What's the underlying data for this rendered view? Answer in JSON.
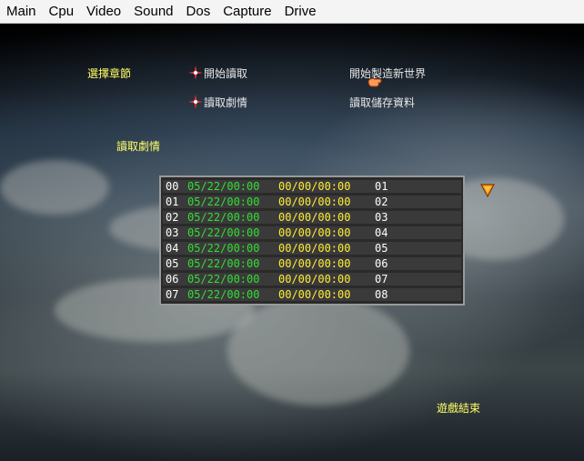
{
  "menubar": {
    "items": [
      "Main",
      "Cpu",
      "Video",
      "Sound",
      "Dos",
      "Capture",
      "Drive"
    ]
  },
  "game": {
    "select_chapter": "選擇章節",
    "start_read": "開始讀取",
    "start_new_world": "開始製造新世界",
    "read_story": "讀取劇情",
    "read_save_data": "讀取儲存資料",
    "section_title": "讀取劇情",
    "quit_game": "遊戲結束"
  },
  "saves": {
    "rows": [
      {
        "idx": "00",
        "date": "05/22/00:00",
        "time": "00/00/00:00",
        "num": "01"
      },
      {
        "idx": "01",
        "date": "05/22/00:00",
        "time": "00/00/00:00",
        "num": "02"
      },
      {
        "idx": "02",
        "date": "05/22/00:00",
        "time": "00/00/00:00",
        "num": "03"
      },
      {
        "idx": "03",
        "date": "05/22/00:00",
        "time": "00/00/00:00",
        "num": "04"
      },
      {
        "idx": "04",
        "date": "05/22/00:00",
        "time": "00/00/00:00",
        "num": "05"
      },
      {
        "idx": "05",
        "date": "05/22/00:00",
        "time": "00/00/00:00",
        "num": "06"
      },
      {
        "idx": "06",
        "date": "05/22/00:00",
        "time": "00/00/00:00",
        "num": "07"
      },
      {
        "idx": "07",
        "date": "05/22/00:00",
        "time": "00/00/00:00",
        "num": "08"
      }
    ]
  },
  "colors": {
    "label_yellow": "#ffff66",
    "date_green": "#33dd33",
    "time_yellow": "#ffee33",
    "arrow_orange": "#ff9900"
  },
  "icons": [
    "star-marker-icon",
    "hand-cursor-icon",
    "scroll-down-arrow-icon"
  ]
}
